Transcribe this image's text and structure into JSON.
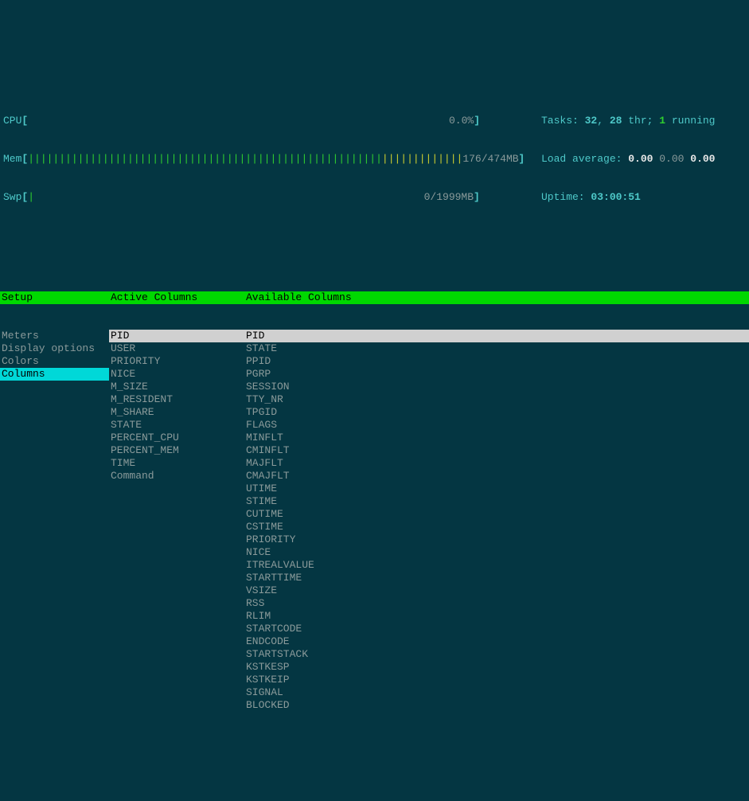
{
  "meters": {
    "cpu": {
      "label": "CPU",
      "value": "0.0%"
    },
    "mem": {
      "label": "Mem",
      "used": "176",
      "total": "474MB"
    },
    "swp": {
      "label": "Swp",
      "used": "0",
      "total": "1999MB"
    }
  },
  "stats": {
    "tasks_label": "Tasks: ",
    "tasks_count": "32",
    "tasks_sep": ", ",
    "threads": "28",
    "thr_label": " thr; ",
    "running": "1",
    "running_label": " running",
    "load_label": "Load average: ",
    "load1": "0.00",
    "load2": "0.00",
    "load3": "0.00",
    "uptime_label": "Uptime: ",
    "uptime": "03:00:51"
  },
  "setup": {
    "header": "Setup",
    "items": [
      "Meters",
      "Display options",
      "Colors",
      "Columns"
    ],
    "selected_index": 3
  },
  "active": {
    "header": "Active Columns",
    "items": [
      "PID",
      "USER",
      "PRIORITY",
      "NICE",
      "M_SIZE",
      "M_RESIDENT",
      "M_SHARE",
      "STATE",
      "PERCENT_CPU",
      "PERCENT_MEM",
      "TIME",
      "Command"
    ],
    "selected_index": 0
  },
  "available": {
    "header": "Available Columns",
    "items": [
      "PID",
      "STATE",
      "PPID",
      "PGRP",
      "SESSION",
      "TTY_NR",
      "TPGID",
      "FLAGS",
      "MINFLT",
      "CMINFLT",
      "MAJFLT",
      "CMAJFLT",
      "UTIME",
      "STIME",
      "CUTIME",
      "CSTIME",
      "PRIORITY",
      "NICE",
      "ITREALVALUE",
      "STARTTIME",
      "VSIZE",
      "RSS",
      "RLIM",
      "STARTCODE",
      "ENDCODE",
      "STARTSTACK",
      "KSTKESP",
      "KSTKEIP",
      "SIGNAL",
      "BLOCKED"
    ],
    "selected_index": 0
  }
}
